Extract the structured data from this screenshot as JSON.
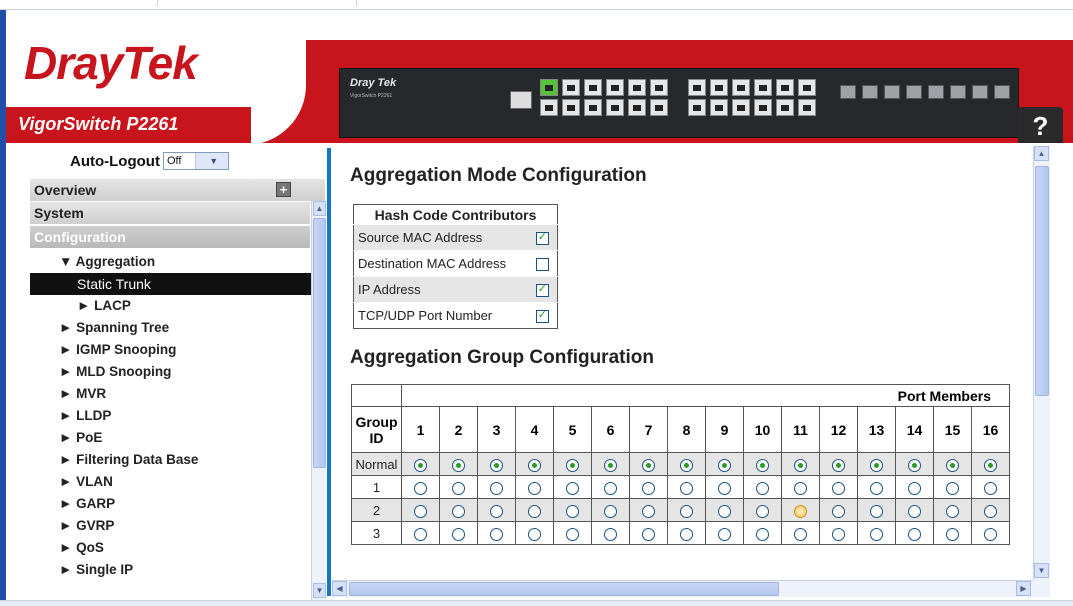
{
  "header": {
    "brand": "DrayTek",
    "model": "VigorSwitch P2261",
    "device_brand": "Dray Tek",
    "device_model": "VigorSwitch P2261",
    "help_label": "?"
  },
  "sidebar": {
    "autologout_label": "Auto-Logout",
    "autologout_value": "Off",
    "overview": "Overview",
    "system": "System",
    "configuration": "Configuration",
    "items": [
      {
        "label": "▼ Aggregation",
        "level": 1
      },
      {
        "label": "Static Trunk",
        "level": 2,
        "selected": true
      },
      {
        "label": "► LACP",
        "level": 2
      },
      {
        "label": "► Spanning Tree",
        "level": 1
      },
      {
        "label": "► IGMP Snooping",
        "level": 1
      },
      {
        "label": "► MLD Snooping",
        "level": 1
      },
      {
        "label": "► MVR",
        "level": 1
      },
      {
        "label": "► LLDP",
        "level": 1
      },
      {
        "label": "► PoE",
        "level": 1
      },
      {
        "label": "► Filtering Data Base",
        "level": 1
      },
      {
        "label": "► VLAN",
        "level": 1
      },
      {
        "label": "► GARP",
        "level": 1
      },
      {
        "label": "► GVRP",
        "level": 1
      },
      {
        "label": "► QoS",
        "level": 1
      },
      {
        "label": "► Single IP",
        "level": 1
      }
    ]
  },
  "main": {
    "mode_title": "Aggregation Mode Configuration",
    "hash_header": "Hash Code Contributors",
    "hash_rows": [
      {
        "label": "Source MAC Address",
        "checked": true
      },
      {
        "label": "Destination MAC Address",
        "checked": false
      },
      {
        "label": "IP Address",
        "checked": true
      },
      {
        "label": "TCP/UDP Port Number",
        "checked": true
      }
    ],
    "group_title": "Aggregation Group Configuration",
    "port_members_label": "Port Members",
    "group_id_label": "Group ID",
    "ports": [
      "1",
      "2",
      "3",
      "4",
      "5",
      "6",
      "7",
      "8",
      "9",
      "10",
      "11",
      "12",
      "13",
      "14",
      "15",
      "16"
    ],
    "groups": [
      {
        "id": "Normal",
        "selected_all": true
      },
      {
        "id": "1",
        "selected_all": false
      },
      {
        "id": "2",
        "selected_all": false,
        "hover_port": 11
      },
      {
        "id": "3",
        "selected_all": false
      }
    ]
  },
  "colors": {
    "brand_red": "#c8141c",
    "accent_blue": "#1577c4",
    "selected_menu_bg": "#111111"
  }
}
